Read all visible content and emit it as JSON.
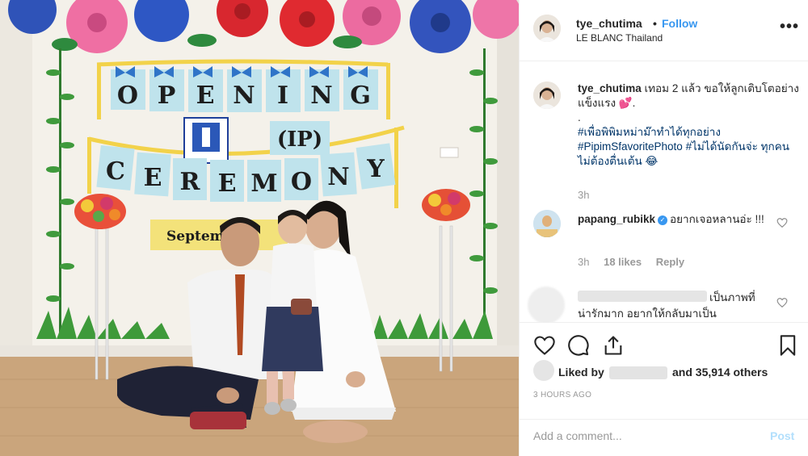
{
  "header": {
    "username": "tye_chutima",
    "dot": "•",
    "follow_label": "Follow",
    "location": "LE BLANC Thailand",
    "more_icon": "more-icon"
  },
  "photo": {
    "banner_top": [
      "O",
      "P",
      "E",
      "N",
      "I",
      "N",
      "G"
    ],
    "banner_mid": "(IP)",
    "banner_bottom": [
      "C",
      "E",
      "R",
      "E",
      "M",
      "O",
      "N",
      "Y"
    ],
    "date_sign": "Septem   03"
  },
  "caption": {
    "username": "tye_chutima",
    "text": "เทอม 2 แล้ว ขอให้ลูกเติบโตอย่างแข็งแรง 💕.",
    "dot": ".",
    "hashtag1": "#เพื่อพิพิมหม่าม๊าทำได้ทุกอย่าง",
    "hashtag2": "#PipimSfavoritePhoto",
    "tail": "#ไม่ได้นัดกันจ่ะ ทุกคนไม่ต้องตื่นเต้น 😂",
    "time": "3h"
  },
  "comment2": {
    "username": "papang_rubikk",
    "text": "อยากเจอหลานอ่ะ !!!",
    "time": "3h",
    "likes": "18 likes",
    "reply": "Reply"
  },
  "comment3": {
    "text1": "เป็นภาพที่",
    "text2": "น่ารักมาก อยากให้กลับมาเป็น"
  },
  "actions": {
    "liked_by": "Liked by",
    "others": "and 35,914 others",
    "ago": "3 HOURS AGO"
  },
  "add_comment": {
    "placeholder": "Add a comment...",
    "post_label": "Post"
  },
  "colors": {
    "link_blue": "#3897f0",
    "hashtag": "#003569",
    "muted": "#999999"
  }
}
